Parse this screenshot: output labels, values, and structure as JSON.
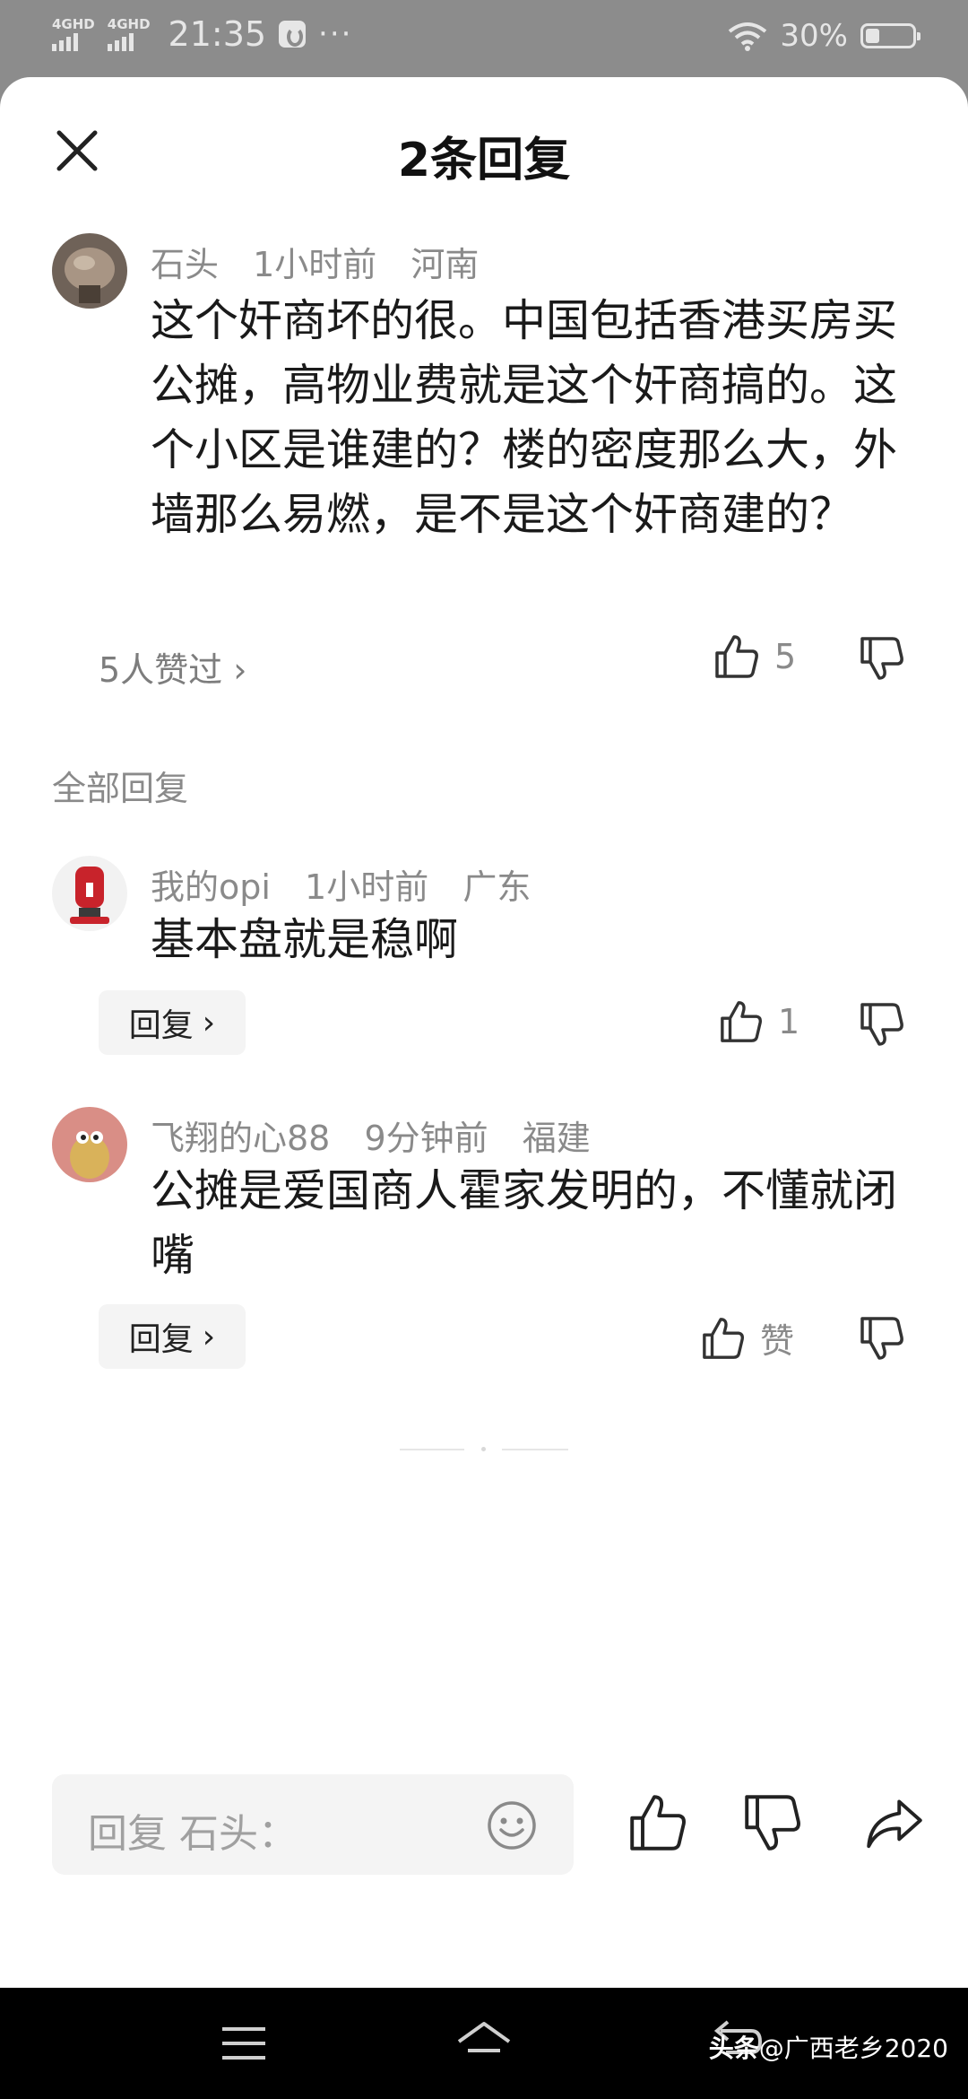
{
  "status_bar": {
    "network_1": "4GHD",
    "network_2": "4GHD",
    "time": "21:35",
    "more": "···",
    "battery_percent": "30%",
    "battery_level": 0.3
  },
  "sheet": {
    "title": "2条回复"
  },
  "main_comment": {
    "username": "石头",
    "time": "1小时前",
    "location": "河南",
    "text": "这个奸商坏的很。中国包括香港买房买公摊，高物业费就是这个奸商搞的。这个小区是谁建的？楼的密度那么大，外墙那么易燃，是不是这个奸商建的？",
    "likes_link": "5人赞过",
    "like_count": "5"
  },
  "section_label": "全部回复",
  "replies": [
    {
      "username": "我的opi",
      "time": "1小时前",
      "location": "广东",
      "text": "基本盘就是稳啊",
      "reply_label": "回复",
      "like_count": "1"
    },
    {
      "username": "飞翔的心88",
      "time": "9分钟前",
      "location": "福建",
      "text": "公摊是爱国商人霍家发明的，不懂就闭嘴",
      "reply_label": "回复",
      "like_count": "赞"
    }
  ],
  "bottom_bar": {
    "input_placeholder": "回复 石头："
  },
  "watermark": {
    "brand": "头条",
    "handle": "@广西老乡2020"
  },
  "icons": {
    "close": "close-icon",
    "like": "thumbs-up-icon",
    "dislike": "thumbs-down-icon",
    "emoji": "smiley-icon",
    "share": "share-arrow-icon",
    "menu": "menu-icon",
    "home": "home-icon",
    "back": "back-icon"
  },
  "colors": {
    "text_muted": "#8a8a8a",
    "surface": "#f4f4f4",
    "scrim": "#8c8c8c"
  }
}
